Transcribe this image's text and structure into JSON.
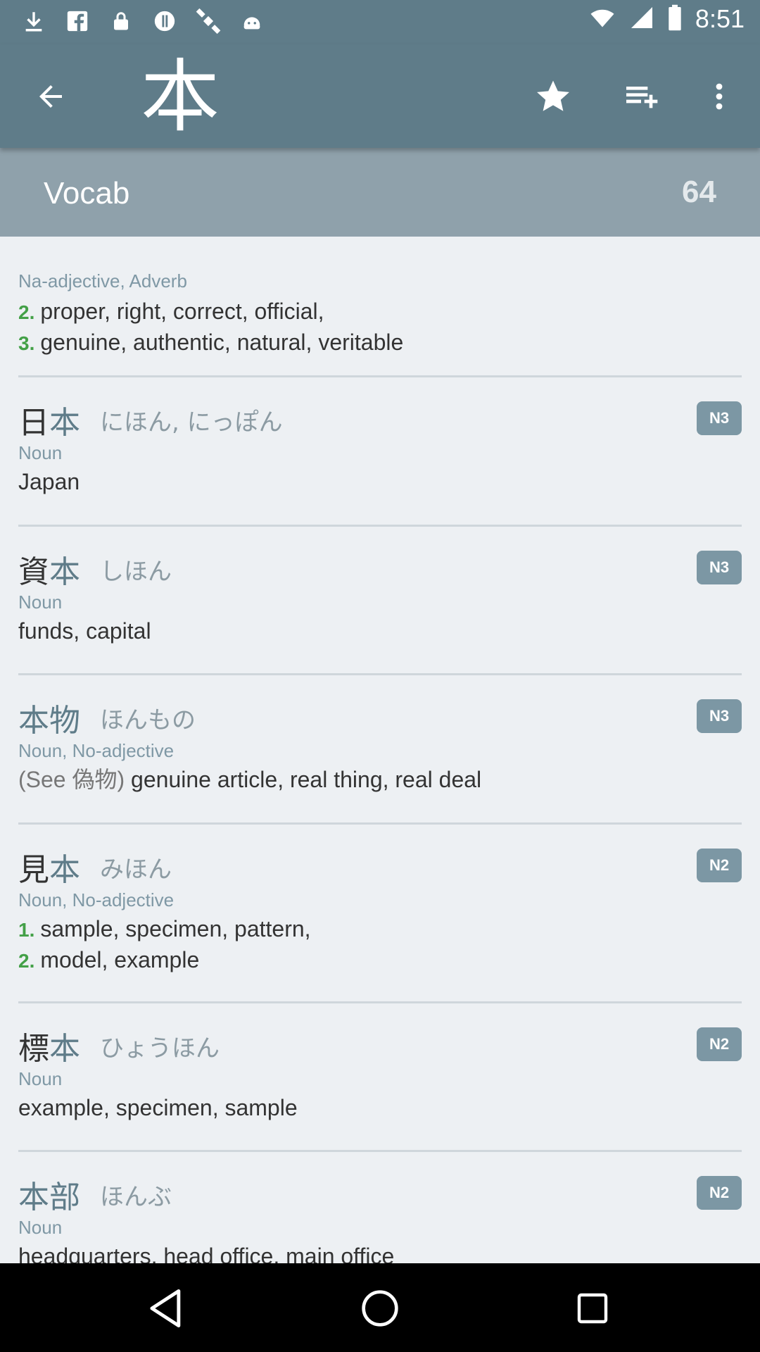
{
  "status_bar": {
    "time": "8:51",
    "icons": [
      "download-icon",
      "facebook-icon",
      "lock-icon",
      "fake-gps-icon",
      "satellite-icon",
      "android-icon",
      "wifi-icon",
      "signal-icon",
      "battery-icon"
    ]
  },
  "app_bar": {
    "title_kanji": "本",
    "actions": [
      "star-icon",
      "playlist-add-icon",
      "more-vert-icon"
    ]
  },
  "section": {
    "title": "Vocab",
    "count": "64"
  },
  "entries": [
    {
      "kanji_plain": "",
      "kanji_hl": "",
      "reading": "",
      "level": "",
      "pos": "Na-adjective, Adverb",
      "meanings": [
        {
          "num": "2.",
          "text": "proper, right, correct, official,"
        },
        {
          "num": "3.",
          "text": "genuine, authentic, natural, veritable"
        }
      ]
    },
    {
      "kanji_plain": "日",
      "kanji_hl": "本",
      "reading": "にほん, にっぽん",
      "level": "N3",
      "pos": "Noun",
      "meanings": [
        {
          "num": "",
          "text": "Japan"
        }
      ]
    },
    {
      "kanji_plain": "資",
      "kanji_hl": "本",
      "reading": "しほん",
      "level": "N3",
      "pos": "Noun",
      "meanings": [
        {
          "num": "",
          "text": "funds, capital"
        }
      ]
    },
    {
      "kanji_hl": "本",
      "kanji_plain": "物",
      "reading": "ほんもの",
      "level": "N3",
      "pos": "Noun, No-adjective",
      "meanings": [
        {
          "num": "",
          "note": "(See 偽物)",
          "text": "genuine article, real thing, real deal"
        }
      ]
    },
    {
      "kanji_plain": "見",
      "kanji_hl": "本",
      "reading": "みほん",
      "level": "N2",
      "pos": "Noun, No-adjective",
      "meanings": [
        {
          "num": "1.",
          "text": "sample, specimen, pattern,"
        },
        {
          "num": "2.",
          "text": "model, example"
        }
      ]
    },
    {
      "kanji_plain": "標",
      "kanji_hl": "本",
      "reading": "ひょうほん",
      "level": "N2",
      "pos": "Noun",
      "meanings": [
        {
          "num": "",
          "text": "example, specimen, sample"
        }
      ]
    },
    {
      "kanji_hl": "本",
      "kanji_plain": "部",
      "reading": "ほんぶ",
      "level": "N2",
      "pos": "Noun",
      "meanings": [
        {
          "num": "",
          "text": "headquarters, head office, main office"
        }
      ]
    }
  ],
  "colors": {
    "primary": "#5f7c89",
    "section_header": "#8fa1ab",
    "list_bg": "#edf0f3",
    "badge": "#7c97a4",
    "number_green": "#43a047"
  },
  "nav_bar": {
    "buttons": [
      "back-triangle-icon",
      "home-circle-icon",
      "recents-square-icon"
    ]
  }
}
